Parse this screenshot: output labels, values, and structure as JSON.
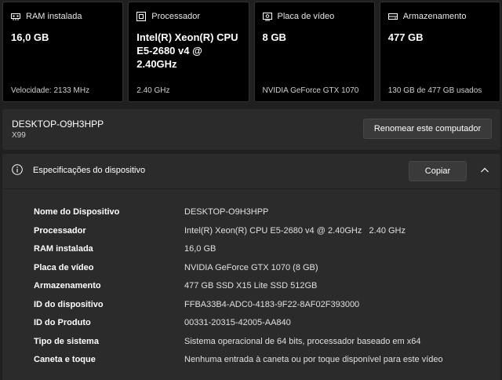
{
  "cards": [
    {
      "icon": "ram-icon",
      "title": "RAM instalada",
      "value": "16,0 GB",
      "footer": "Velocidade: 2133 MHz"
    },
    {
      "icon": "processor-icon",
      "title": "Processador",
      "value": "Intel(R) Xeon(R) CPU E5-2680 v4 @ 2.40GHz",
      "footer": "2.40 GHz"
    },
    {
      "icon": "display-adapter-icon",
      "title": "Placa de vídeo",
      "value": "8 GB",
      "footer": "NVIDIA GeForce GTX 1070"
    },
    {
      "icon": "storage-icon",
      "title": "Armazenamento",
      "value": "477 GB",
      "footer": "130 GB de 477 GB usados"
    }
  ],
  "computer": {
    "name": "DESKTOP-O9H3HPP",
    "model": "X99",
    "rename_label": "Renomear este computador"
  },
  "specs": {
    "title": "Especificações do dispositivo",
    "copy_label": "Copiar",
    "rows": [
      {
        "label": "Nome do Dispositivo",
        "value": "DESKTOP-O9H3HPP"
      },
      {
        "label": "Processador",
        "value": "Intel(R) Xeon(R) CPU E5-2680 v4 @ 2.40GHz   2.40 GHz"
      },
      {
        "label": "RAM instalada",
        "value": "16,0 GB"
      },
      {
        "label": "Placa de vídeo",
        "value": "NVIDIA GeForce GTX 1070 (8 GB)"
      },
      {
        "label": "Armazenamento",
        "value": "477 GB SSD X15 Lite SSD 512GB"
      },
      {
        "label": "ID do dispositivo",
        "value": "FFBA33B4-ADC0-4183-9F22-8AF02F393000"
      },
      {
        "label": "ID do Produto",
        "value": "00331-20315-42005-AA840"
      },
      {
        "label": "Tipo de sistema",
        "value": "Sistema operacional de 64 bits, processador baseado em x64"
      },
      {
        "label": "Caneta e toque",
        "value": "Nenhuma entrada à caneta ou por toque disponível para este vídeo"
      }
    ]
  }
}
